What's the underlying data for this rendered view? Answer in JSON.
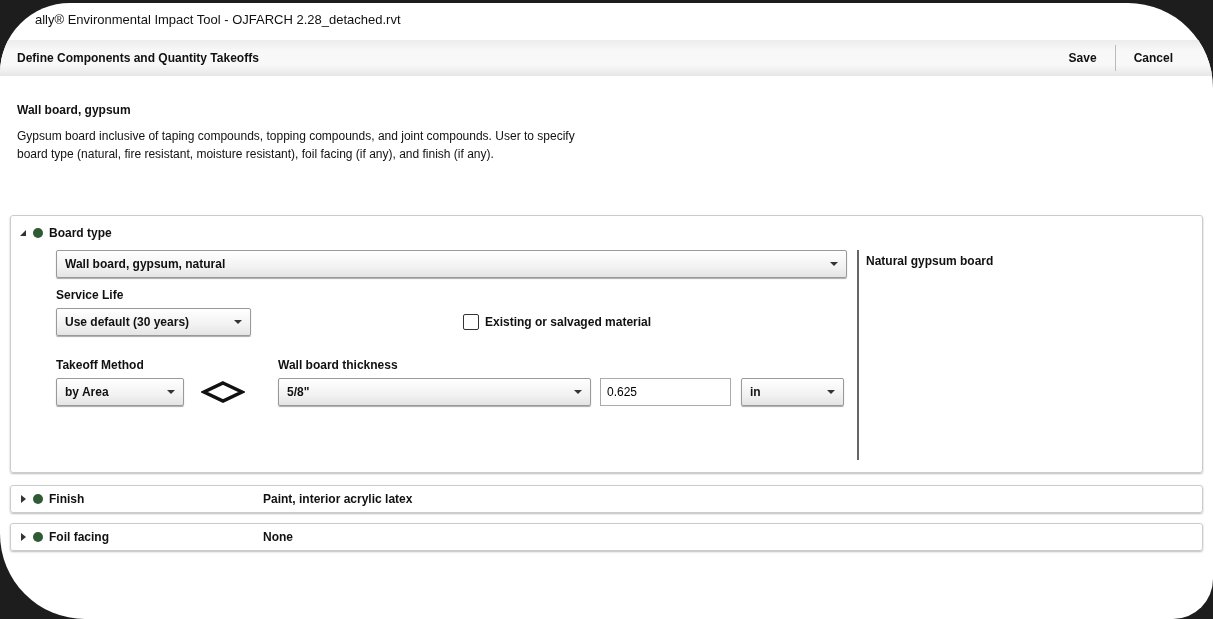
{
  "window": {
    "title": "ally® Environmental Impact Tool - OJFARCH 2.28_detached.rvt"
  },
  "toolbar": {
    "title": "Define Components and Quantity Takeoffs",
    "buttons": [
      "Save",
      "Cancel"
    ]
  },
  "component": {
    "name": "Wall board, gypsum",
    "description": "Gypsum board inclusive of taping compounds, topping compounds, and joint compounds. User to specify board type (natural, fire resistant, moisture resistant), foil facing (if any), and finish (if any)."
  },
  "sections": [
    {
      "name": "Board type",
      "expanded": true,
      "color": "#2f5a33",
      "selection": "Wall board, gypsum, natural",
      "note": "Natural gypsum board",
      "service_life": {
        "label": "Service Life",
        "value": "Use default (30 years)"
      },
      "existing": {
        "label": "Existing or salvaged material",
        "checked": false
      },
      "takeoff": {
        "label": "Takeoff Method",
        "value": "by Area"
      },
      "thickness": {
        "label": "Wall board thickness",
        "value": "5/8\"",
        "amount": "0.625",
        "unit": "in"
      }
    },
    {
      "name": "Finish",
      "expanded": false,
      "color": "#2f5a33",
      "value": "Paint, interior acrylic latex"
    },
    {
      "name": "Foil facing",
      "expanded": false,
      "color": "#2f5a33",
      "value": "None"
    }
  ]
}
